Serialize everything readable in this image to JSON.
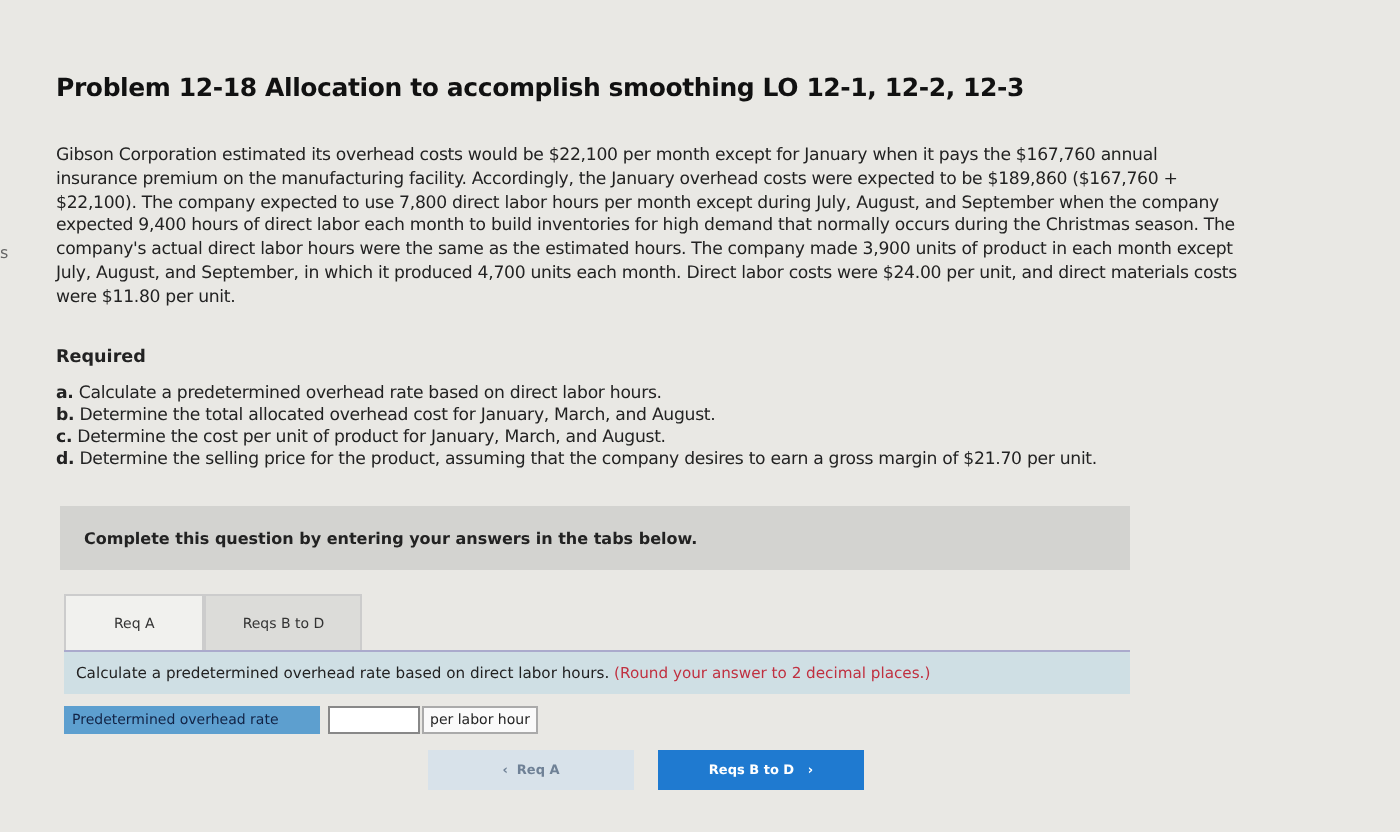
{
  "edge_fragment": "s",
  "title": "Problem 12-18 Allocation to accomplish smoothing LO 12-1, 12-2, 12-3",
  "problem_text": "Gibson Corporation estimated its overhead costs would be $22,100 per month except for January when it pays the $167,760 annual insurance premium on the manufacturing facility. Accordingly, the January overhead costs were expected to be $189,860 ($167,760 + $22,100). The company expected to use 7,800 direct labor hours per month except during July, August, and September when the company expected 9,400 hours of direct labor each month to build inventories for high demand that normally occurs during the Christmas season. The company's actual direct labor hours were the same as the estimated hours. The company made 3,900 units of product in each month except July, August, and September, in which it produced 4,700 units each month. Direct labor costs were $24.00 per unit, and direct materials costs were $11.80 per unit.",
  "required": {
    "heading": "Required",
    "items": [
      {
        "letter": "a.",
        "text": "Calculate a predetermined overhead rate based on direct labor hours."
      },
      {
        "letter": "b.",
        "text": "Determine the total allocated overhead cost for January, March, and August."
      },
      {
        "letter": "c.",
        "text": "Determine the cost per unit of product for January, March, and August."
      },
      {
        "letter": "d.",
        "text": "Determine the selling price for the product, assuming that the company desires to earn a gross margin of $21.70 per unit."
      }
    ]
  },
  "instruction_panel": "Complete this question by entering your answers in the tabs below.",
  "tabs": [
    {
      "label": "Req A",
      "selected": true
    },
    {
      "label": "Reqs B to D",
      "selected": false
    }
  ],
  "question": {
    "text": "Calculate a predetermined overhead rate based on direct labor hours.",
    "note": "(Round your answer to 2 decimal places.)"
  },
  "answer_row": {
    "label": "Predetermined overhead rate",
    "unit": "per labor hour"
  },
  "nav_buttons": [
    {
      "kind": "prev",
      "icon": "‹",
      "label": "Req A",
      "disabled": true
    },
    {
      "kind": "next",
      "icon": "›",
      "label": "Reqs B to D",
      "disabled": false
    }
  ]
}
